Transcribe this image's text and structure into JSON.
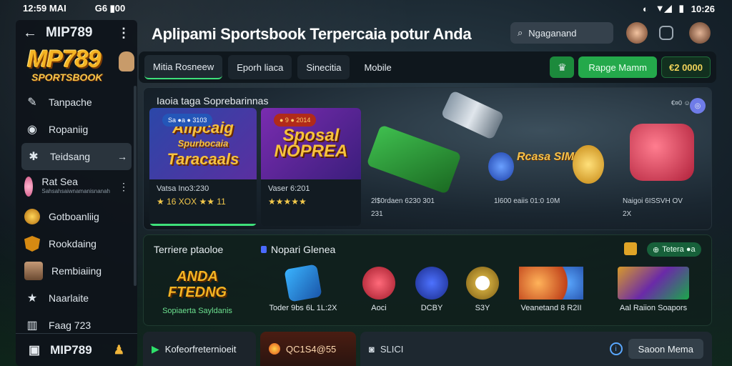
{
  "status_bar": {
    "time_left": "12:59 MAI",
    "network": "G6 ▮00",
    "time_right": "10:26"
  },
  "sidebar": {
    "back_icon": "arrow-left-icon",
    "title": "MIP789",
    "more": "⋮",
    "logo_line1": "MP789",
    "logo_line2": "SPORTSBOOK",
    "items": [
      {
        "label": "Tanpache",
        "icon": "rocket-icon",
        "glyph": "✎"
      },
      {
        "label": "Ropaniig",
        "icon": "chat-bubble-icon",
        "glyph": "◉"
      },
      {
        "label": "Teidsang",
        "icon": "puzzle-icon",
        "glyph": "✱",
        "arrow": "→"
      },
      {
        "label": "Rat Sea",
        "sub": "Sahsahsaiwnamanisnanah",
        "icon": "avatar-pink-icon"
      },
      {
        "label": "Gotboanliig",
        "icon": "gold-ball-icon"
      },
      {
        "label": "Rookdaing",
        "icon": "shield-icon"
      },
      {
        "label": "Rembiaiing",
        "icon": "player-avatar-icon"
      },
      {
        "label": "Naarlaite",
        "icon": "star-icon",
        "glyph": "★"
      },
      {
        "label": "Faag 723",
        "icon": "chart-icon",
        "glyph": "▥"
      }
    ],
    "footer": {
      "label": "MIP789",
      "icon": "image-icon",
      "person_icon": "person-icon"
    }
  },
  "header": {
    "title": "Aplipami Sportsbook Terpercaia potur Anda",
    "search_placeholder": "Ngaganand"
  },
  "navbar": {
    "tabs": [
      "Mitia Rosneew",
      "Eporh liaca",
      "Sinecitia",
      "Mobile"
    ],
    "signup_label": "Rapge Mamm",
    "balance": "€2 0000"
  },
  "banner": {
    "title": "Iaoia taga Soprebarinnas",
    "tag": "€¤0 ☺",
    "cards": [
      {
        "pill": "Sa ●a ● 3103",
        "title1": "Alipcaig",
        "title2": "Spurbocaia",
        "title3": "Taracaals",
        "meta": "Vatsa Ino3:230",
        "rating": "★ 16 XOX ★★ 11"
      },
      {
        "pill": "● 9 ● 2014",
        "title1": "Sposal",
        "title2": "NOPREA",
        "meta": "Vaser 6:201",
        "rating": "★★★★★"
      }
    ],
    "stats": [
      {
        "line1": "2l$0rdaen 6230 301",
        "line2": "231"
      },
      {
        "line1": "1l600 eaiis 01:0 10M",
        "line2": ""
      },
      {
        "line1": "Naigoi 6ISSVH OV",
        "line2": "2X"
      }
    ],
    "slot_label": "Rcasa SIMUHS"
  },
  "games": {
    "heading": "Terriere ptaoloe",
    "heading2": "Nopari Glenea",
    "badge": "Tetera ●a",
    "items": [
      {
        "thumb_text": "ANDA FTEDNG",
        "caption": "Sopiaerta Sayldanis"
      },
      {
        "caption": "Toder 9bs 6L 1L:2X"
      },
      {
        "caption": "Aoci"
      },
      {
        "caption": "DCBY"
      },
      {
        "caption": "S3Y"
      },
      {
        "caption": "Veanetand 8 R2II"
      },
      {
        "caption": "Aal Raiion Soapors"
      }
    ]
  },
  "bottom": {
    "b1_label": "Kofeorfreternioeit",
    "b2_label": "QC1S4@55",
    "b3_label": "SLICI",
    "more_label": "Saoon Mema"
  }
}
